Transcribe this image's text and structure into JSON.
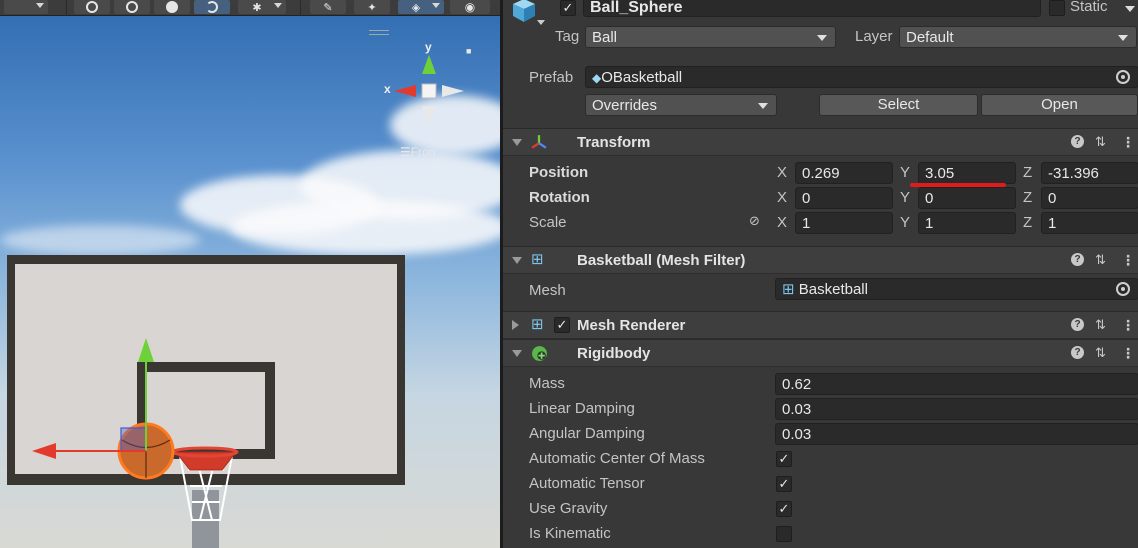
{
  "scene": {
    "gizmo_axes": {
      "y": "y",
      "x": "x"
    },
    "view_label": "Fron",
    "accent_colors": {
      "x_axis": "#e23b2e",
      "y_axis": "#6fd13a",
      "ball": "#d9782c",
      "rim": "#d23b2a"
    }
  },
  "header": {
    "object_active": "✓",
    "object_name": "Ball_Sphere",
    "static_label": "Static",
    "tag_label": "Tag",
    "tag_value": "Ball",
    "layer_label": "Layer",
    "layer_value": "Default",
    "prefab_label": "Prefab",
    "prefab_value": "OBasketball",
    "overrides_label": "Overrides",
    "select_button": "Select",
    "open_button": "Open"
  },
  "transform": {
    "title": "Transform",
    "position_label": "Position",
    "rotation_label": "Rotation",
    "scale_label": "Scale",
    "axes": [
      "X",
      "Y",
      "Z"
    ],
    "position": {
      "x": "0.269",
      "y": "3.05",
      "z": "-31.396"
    },
    "rotation": {
      "x": "0",
      "y": "0",
      "z": "0"
    },
    "scale": {
      "x": "1",
      "y": "1",
      "z": "1"
    }
  },
  "mesh_filter": {
    "title": "Basketball (Mesh Filter)",
    "mesh_label": "Mesh",
    "mesh_value": "Basketball"
  },
  "mesh_renderer": {
    "title": "Mesh Renderer",
    "enabled": "✓"
  },
  "rigidbody": {
    "title": "Rigidbody",
    "mass_label": "Mass",
    "mass": "0.62",
    "linear_damping_label": "Linear Damping",
    "linear_damping": "0.03",
    "angular_damping_label": "Angular Damping",
    "angular_damping": "0.03",
    "auto_com_label": "Automatic Center Of Mass",
    "auto_com": "✓",
    "auto_tensor_label": "Automatic Tensor",
    "auto_tensor": "✓",
    "use_gravity_label": "Use Gravity",
    "use_gravity": "✓",
    "is_kinematic_label": "Is Kinematic",
    "is_kinematic": ""
  },
  "icons": {
    "help": "?",
    "presets": "⇅",
    "more": "⋮"
  }
}
